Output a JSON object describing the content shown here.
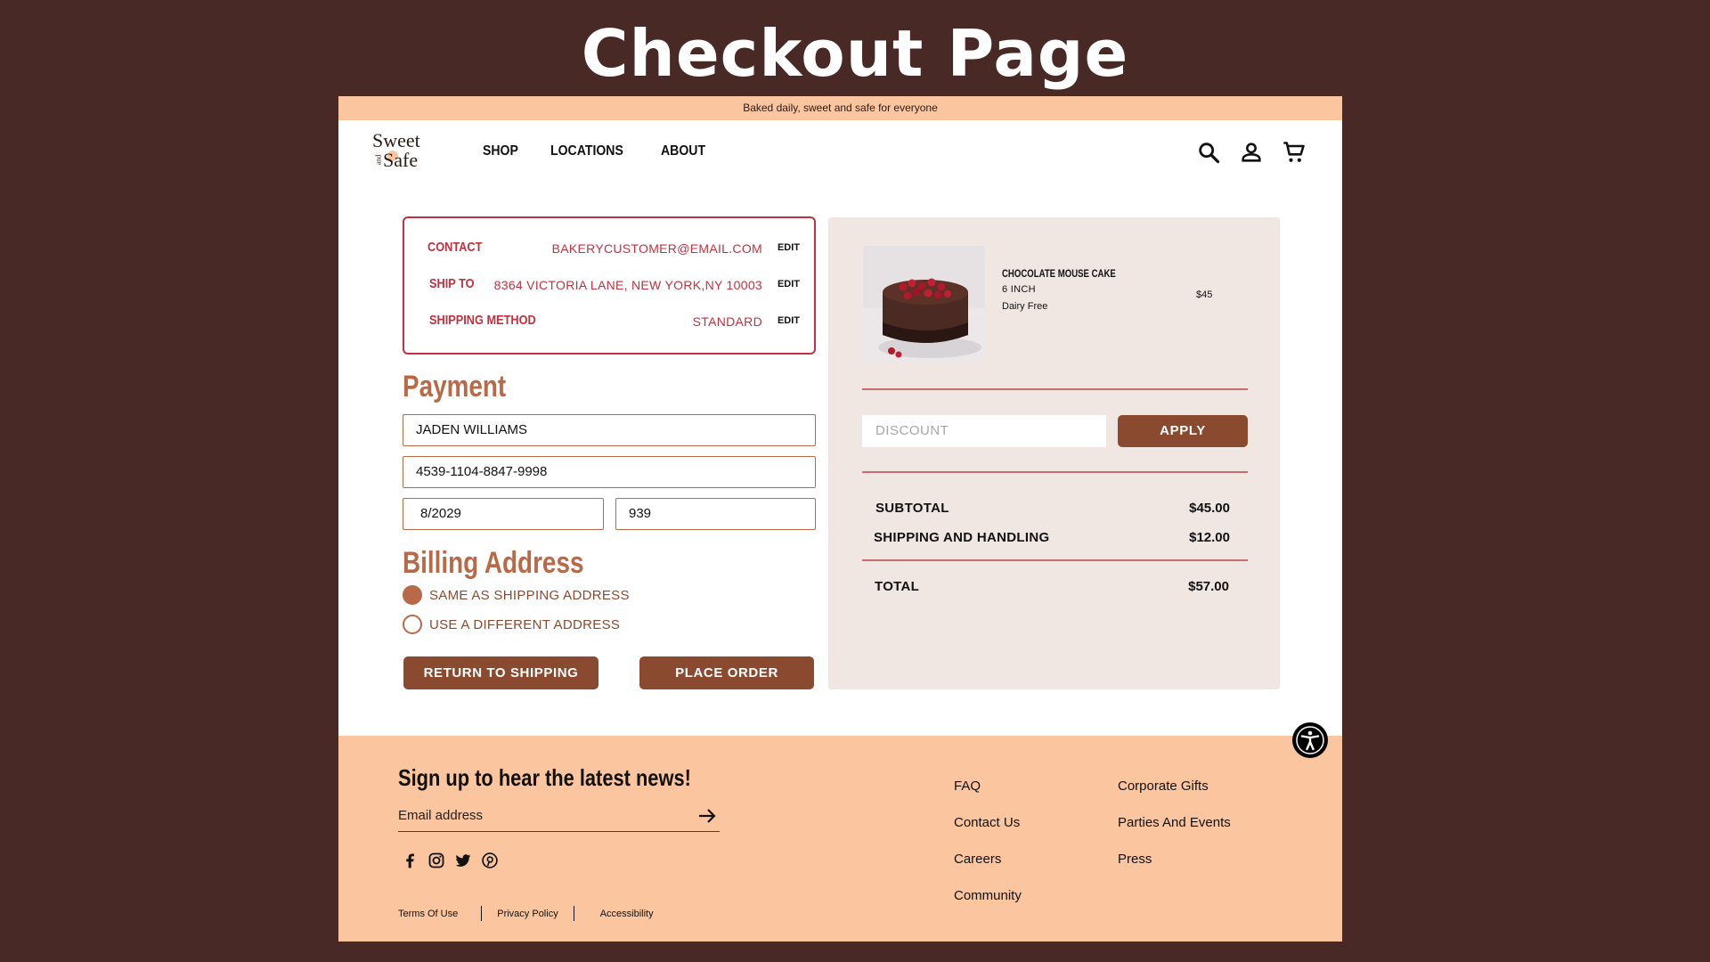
{
  "page_heading": "Checkout Page",
  "announcement": "Baked daily, sweet and safe for everyone",
  "logo": {
    "line1": "Sweet",
    "small": "and",
    "line2": "Safe"
  },
  "nav": {
    "links": [
      "SHOP",
      "LOCATIONS",
      "ABOUT"
    ],
    "icons": [
      "search-icon",
      "account-icon",
      "cart-icon"
    ]
  },
  "contact_box": {
    "rows": [
      {
        "label": "CONTACT",
        "value": "BAKERYCUSTOMER@EMAIL.COM",
        "edit": "EDIT"
      },
      {
        "label": "SHIP TO",
        "value": "8364 VICTORIA LANE, NEW YORK,NY 10003",
        "edit": "EDIT"
      },
      {
        "label": "SHIPPING METHOD",
        "value": "STANDARD",
        "edit": "EDIT"
      }
    ]
  },
  "payment": {
    "title": "Payment",
    "name": "JADEN WILLIAMS",
    "card_number": "4539-1104-8847-9998",
    "expiry": "8/2029",
    "cvv": "939"
  },
  "billing": {
    "title": "Billing Address",
    "options": [
      {
        "label": "SAME AS SHIPPING ADDRESS",
        "selected": true
      },
      {
        "label": "USE A DIFFERENT ADDRESS",
        "selected": false
      }
    ]
  },
  "buttons": {
    "return": "RETURN TO SHIPPING",
    "place_order": "PLACE ORDER",
    "apply": "APPLY"
  },
  "order": {
    "item": {
      "name": "CHOCOLATE MOUSE CAKE",
      "size": "6 INCH",
      "diet": "Dairy Free",
      "price": "$45"
    },
    "discount_placeholder": "DISCOUNT",
    "subtotal": {
      "label": "SUBTOTAL",
      "value": "$45.00"
    },
    "shipping": {
      "label": "SHIPPING AND HANDLING",
      "value": "$12.00"
    },
    "total": {
      "label": "TOTAL",
      "value": "$57.00"
    }
  },
  "footer": {
    "signup_title": "Sign up to hear the latest news!",
    "email_placeholder": "Email address",
    "socials": [
      "facebook-icon",
      "instagram-icon",
      "twitter-icon",
      "pinterest-icon"
    ],
    "legal": [
      "Terms Of Use",
      "Privacy Policy",
      "Accessibility"
    ],
    "col1": [
      "FAQ",
      "Contact Us",
      "Careers",
      "Community"
    ],
    "col2": [
      "Corporate Gifts",
      "Parties And Events",
      "Press"
    ]
  },
  "colors": {
    "background": "#482925",
    "peach": "#fbc59f",
    "brown": "#8a4a2f",
    "accent_red": "#c1313f",
    "summary_bg": "#f0e7e3"
  }
}
